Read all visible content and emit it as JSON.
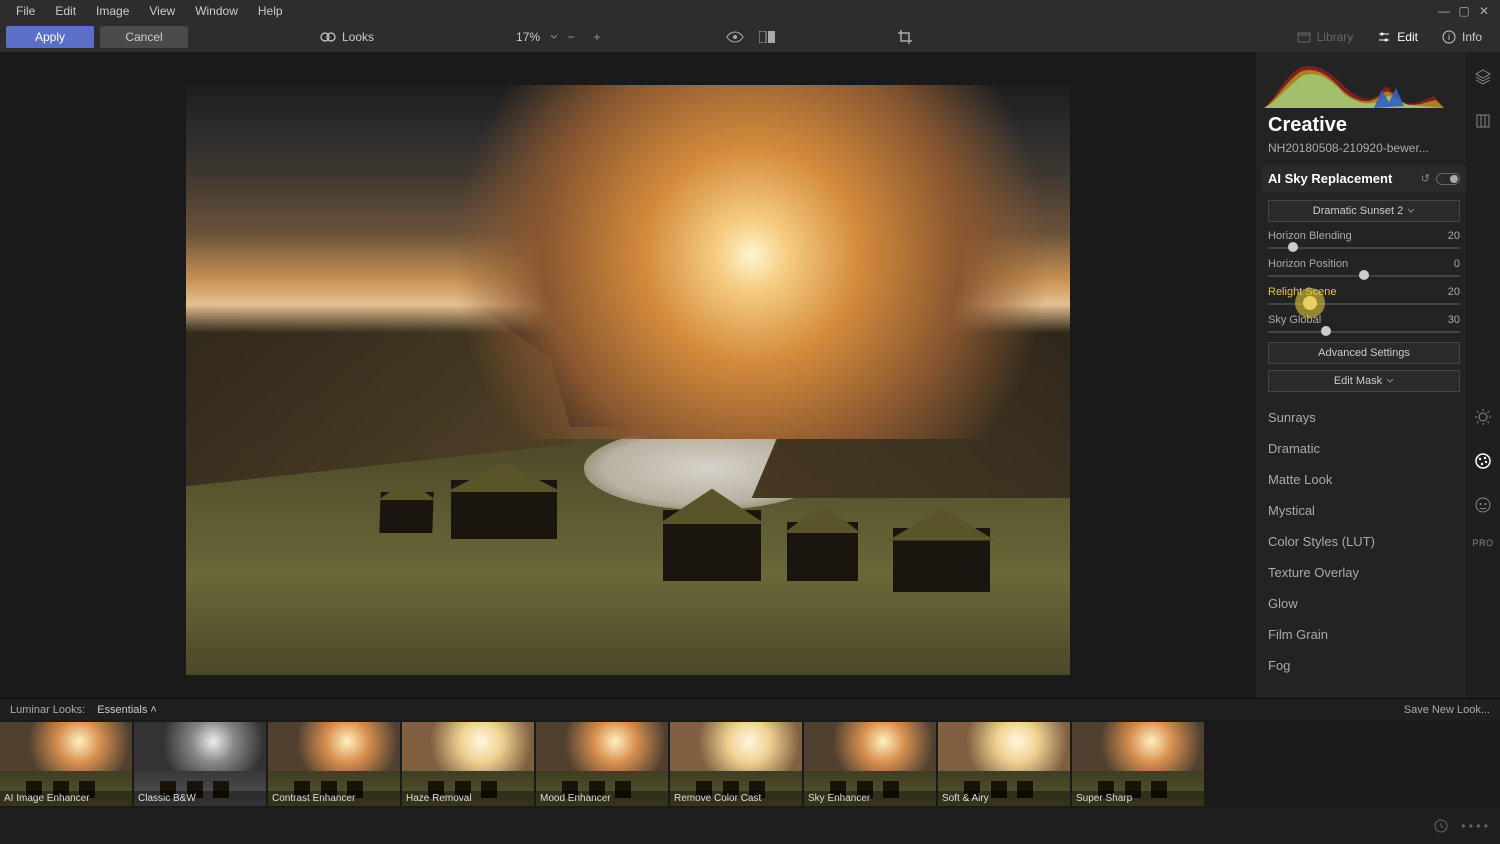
{
  "menu": [
    "File",
    "Edit",
    "Image",
    "View",
    "Window",
    "Help"
  ],
  "toolbar": {
    "apply": "Apply",
    "cancel": "Cancel",
    "looks": "Looks",
    "zoom": "17%"
  },
  "tabs": {
    "library": "Library",
    "edit": "Edit",
    "info": "Info"
  },
  "panel": {
    "title": "Creative",
    "filename": "NH20180508-210920-bewer...",
    "tool_name": "AI Sky Replacement",
    "preset": "Dramatic Sunset 2",
    "sliders": [
      {
        "label": "Horizon Blending",
        "value": "20",
        "pos": 13
      },
      {
        "label": "Horizon Position",
        "value": "0",
        "pos": 50
      },
      {
        "label": "Relight Scene",
        "value": "20",
        "pos": 22,
        "hot": true
      },
      {
        "label": "Sky Global",
        "value": "30",
        "pos": 30
      }
    ],
    "advanced": "Advanced Settings",
    "edit_mask": "Edit Mask",
    "tools": [
      "Sunrays",
      "Dramatic",
      "Matte Look",
      "Mystical",
      "Color Styles (LUT)",
      "Texture Overlay",
      "Glow",
      "Film Grain",
      "Fog"
    ],
    "pro": "PRO"
  },
  "filmstrip": {
    "header_label": "Luminar Looks:",
    "category": "Essentials",
    "save": "Save New Look...",
    "items": [
      "AI Image Enhancer",
      "Classic B&W",
      "Contrast Enhancer",
      "Haze Removal",
      "Mood Enhancer",
      "Remove Color Cast",
      "Sky Enhancer",
      "Soft & Airy",
      "Super Sharp"
    ]
  }
}
